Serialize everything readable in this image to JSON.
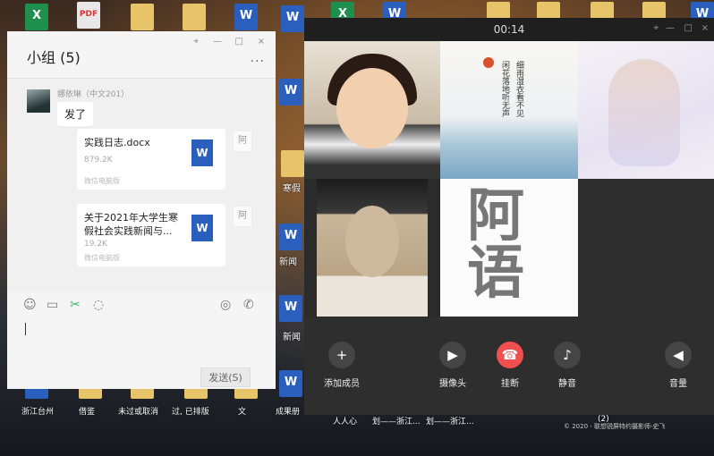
{
  "desktop": {
    "top_icons": [
      {
        "kind": "xls",
        "glyph": "X"
      },
      {
        "kind": "pdf",
        "glyph": "PDF"
      },
      {
        "kind": "folder",
        "glyph": ""
      },
      {
        "kind": "folder",
        "glyph": ""
      },
      {
        "kind": "word",
        "glyph": "W"
      },
      {
        "kind": "word",
        "glyph": "W"
      },
      {
        "kind": "xls",
        "glyph": "X"
      },
      {
        "kind": "word",
        "glyph": "W"
      },
      {
        "kind": "folder",
        "glyph": ""
      },
      {
        "kind": "folder",
        "glyph": ""
      },
      {
        "kind": "folder",
        "glyph": ""
      },
      {
        "kind": "folder",
        "glyph": ""
      },
      {
        "kind": "word",
        "glyph": "W"
      }
    ],
    "side_labels": [
      "寒假",
      "新闻",
      "新闻"
    ],
    "bottom_labels": [
      "浙江台州",
      "借鉴",
      "未过或取消",
      "过, 已排版",
      "文",
      "成果册"
    ],
    "video_bottom_labels": [
      "人人心",
      "划——浙江...",
      "划——浙江...",
      "(2)"
    ],
    "copyright": "© 2020 - 联想锐屏特约摄影师-史飞"
  },
  "chat": {
    "title": "小组 (5)",
    "window_buttons": [
      "⌖",
      "—",
      "□",
      "×"
    ],
    "more": "···",
    "sender": "娜依琳（中文201）",
    "message": "发了",
    "files": [
      {
        "name": "实践日志.docx",
        "size": "879.2K",
        "source": "微信电脑版",
        "sig": "阿"
      },
      {
        "name": "关于2021年大学生寒假社会实践新闻与...",
        "size": "19.2K",
        "source": "微信电脑版",
        "sig": "阿"
      }
    ],
    "send_label": "发送(S)"
  },
  "video": {
    "timer": "00:14",
    "window_buttons": [
      "⌖",
      "—",
      "□",
      "×"
    ],
    "poem": [
      "细雨湿衣看不见",
      "闲花落地听无声"
    ],
    "callig": "阿语",
    "controls": [
      {
        "label": "添加成员",
        "glyph": "+"
      },
      {
        "label": "摄像头",
        "glyph": "▶"
      },
      {
        "label": "挂断",
        "glyph": "☎"
      },
      {
        "label": "静音",
        "glyph": "♪"
      },
      {
        "label": "音量",
        "glyph": "◀"
      }
    ]
  }
}
